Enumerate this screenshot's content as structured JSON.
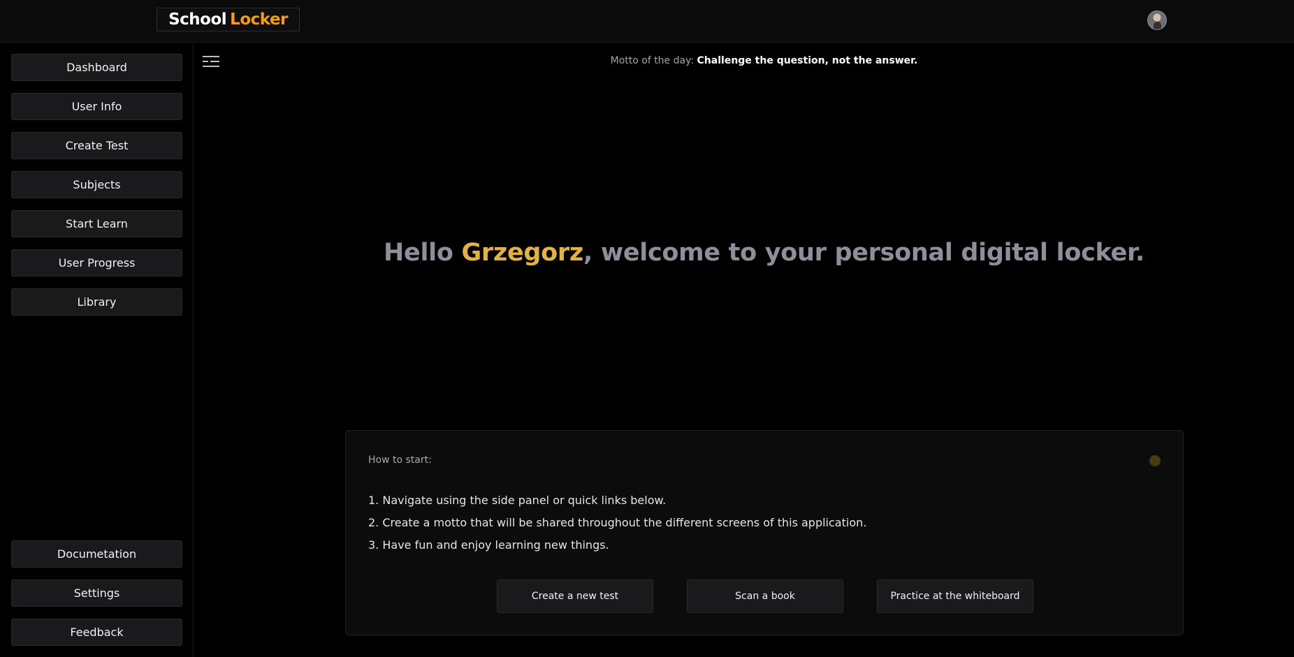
{
  "header": {
    "logo_part1": "School",
    "logo_part2": "Locker",
    "logo_accent_color": "#f59e0b"
  },
  "sidebar": {
    "top_items": [
      {
        "label": "Dashboard"
      },
      {
        "label": "User Info"
      },
      {
        "label": "Create Test"
      },
      {
        "label": "Subjects"
      },
      {
        "label": "Start Learn"
      },
      {
        "label": "User Progress"
      },
      {
        "label": "Library"
      }
    ],
    "bottom_items": [
      {
        "label": "Documetation"
      },
      {
        "label": "Settings"
      },
      {
        "label": "Feedback"
      }
    ]
  },
  "main": {
    "motto_prefix": "Motto of the day:",
    "motto_text": "Challenge the question, not the answer.",
    "greeting_prefix": "Hello",
    "user_name": "Grzegorz",
    "greeting_suffix": ", welcome to your personal digital locker.",
    "name_color": "#e3b341"
  },
  "card": {
    "title": "How to start:",
    "steps": [
      "1. Navigate using the side panel or quick links below.",
      "2. Create a motto that will be shared throughout the different screens of this application.",
      "3. Have fun and enjoy learning new things."
    ],
    "actions": [
      {
        "label": "Create a new test"
      },
      {
        "label": "Scan a book"
      },
      {
        "label": "Practice at the whiteboard"
      }
    ]
  },
  "icons": {
    "menu_toggle": "menu-lines-icon",
    "avatar": "user-avatar"
  }
}
